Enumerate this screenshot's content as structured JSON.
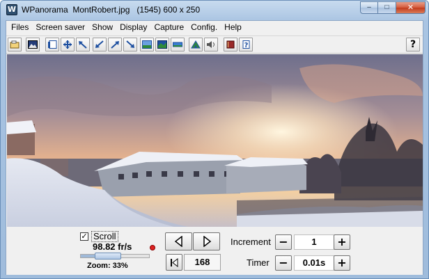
{
  "window": {
    "title": "WPanorama  MontRobert.jpg   (1545) 600 x 250",
    "buttons": {
      "minimize": "–",
      "maximize": "□",
      "close": "✕"
    }
  },
  "menu": [
    "Files",
    "Screen saver",
    "Show",
    "Display",
    "Capture",
    "Config.",
    "Help"
  ],
  "toolbar": {
    "icons": [
      "open-folder-icon",
      "picture-icon",
      "pages-icon",
      "move-arrows-icon",
      "arrow-up-left-icon",
      "arrow-down-left-icon",
      "arrow-up-right-icon",
      "arrow-down-right-icon",
      "landscape-icon",
      "panorama-icon",
      "panorama-wide-icon",
      "mountain-icon",
      "speaker-icon",
      "book-icon",
      "help-page-icon"
    ],
    "help_label": "?",
    "colors": {
      "icon_blue": "#1d4fa0",
      "icon_green": "#2e8a3a"
    }
  },
  "controls": {
    "scroll_label": "Scroll",
    "scroll_checked": "✓",
    "fps": "98.82 fr/s",
    "zoom_label": "Zoom: 33%",
    "zoom_value": 0.33,
    "frame_value": "168",
    "increment_label": "Increment",
    "increment_value": "1",
    "timer_label": "Timer",
    "timer_value": "0.01s",
    "minus": "−",
    "plus": "+"
  }
}
